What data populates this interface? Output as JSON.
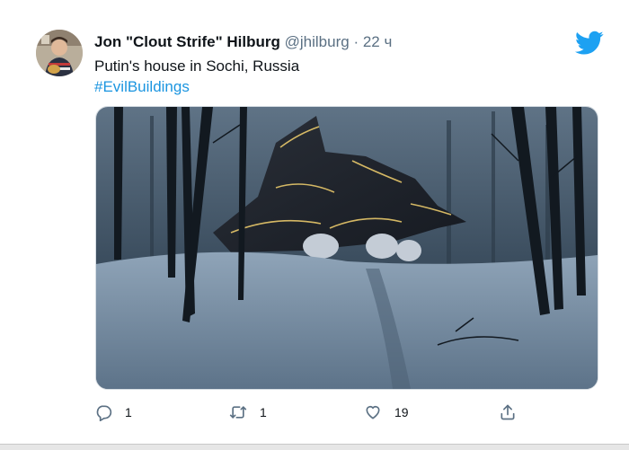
{
  "tweet": {
    "author_name": "Jon \"Clout Strife\" Hilburg",
    "handle": "@jhilburg",
    "separator": "·",
    "time": "22 ч",
    "text": "Putin's house in Sochi, Russia",
    "hashtag": "#EvilBuildings"
  },
  "actions": {
    "reply_count": "1",
    "retweet_count": "1",
    "like_count": "19"
  },
  "icons": {
    "logo": "twitter-bird-icon",
    "reply": "reply-icon",
    "retweet": "retweet-icon",
    "like": "heart-icon",
    "share": "share-icon"
  },
  "colors": {
    "brand": "#1da1f2",
    "link": "#1b95e0",
    "muted": "#5b7083",
    "text": "#0f1419"
  }
}
